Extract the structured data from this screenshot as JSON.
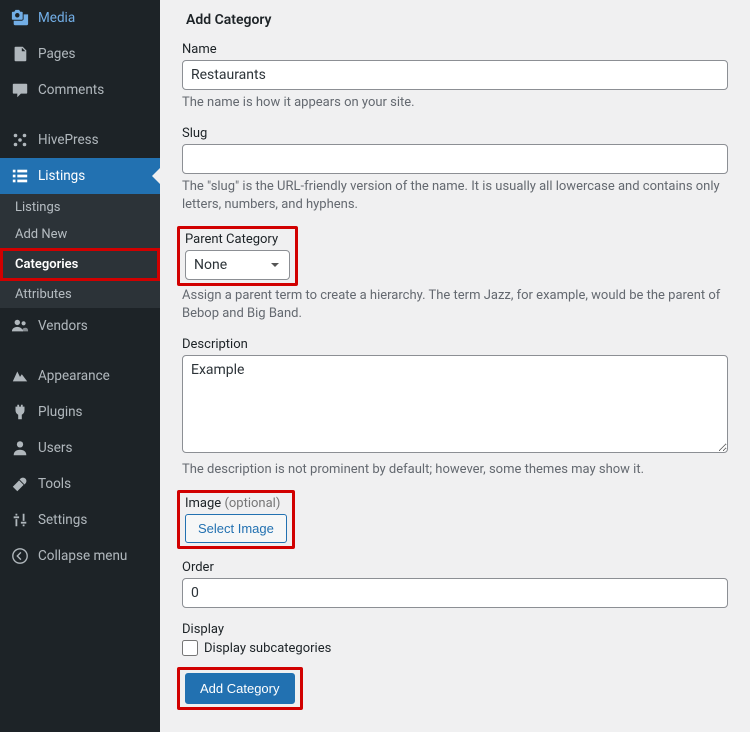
{
  "sidebar": {
    "items": [
      {
        "icon": "media",
        "label": "Media"
      },
      {
        "icon": "page",
        "label": "Pages"
      },
      {
        "icon": "comment",
        "label": "Comments"
      },
      {
        "icon": "hivepress",
        "label": "HivePress"
      },
      {
        "icon": "list",
        "label": "Listings"
      },
      {
        "icon": "vendor",
        "label": "Vendors"
      },
      {
        "icon": "appearance",
        "label": "Appearance"
      },
      {
        "icon": "plugin",
        "label": "Plugins"
      },
      {
        "icon": "user",
        "label": "Users"
      },
      {
        "icon": "tool",
        "label": "Tools"
      },
      {
        "icon": "settings",
        "label": "Settings"
      },
      {
        "icon": "collapse",
        "label": "Collapse menu"
      }
    ],
    "submenu": [
      "Listings",
      "Add New",
      "Categories",
      "Attributes"
    ],
    "active_index": 4,
    "submenu_current_index": 2
  },
  "page": {
    "title": "Add Category",
    "name_label": "Name",
    "name_value": "Restaurants",
    "name_help": "The name is how it appears on your site.",
    "slug_label": "Slug",
    "slug_value": "",
    "slug_help": "The \"slug\" is the URL-friendly version of the name. It is usually all lowercase and contains only letters, numbers, and hyphens.",
    "parent_label": "Parent Category",
    "parent_value": "None",
    "parent_help": "Assign a parent term to create a hierarchy. The term Jazz, for example, would be the parent of Bebop and Big Band.",
    "desc_label": "Description",
    "desc_value": "Example",
    "desc_help": "The description is not prominent by default; however, some themes may show it.",
    "image_label": "Image",
    "image_optional": "(optional)",
    "image_button": "Select Image",
    "order_label": "Order",
    "order_value": "0",
    "display_label": "Display",
    "display_checkbox": "Display subcategories",
    "submit": "Add Category"
  },
  "colors": {
    "accent": "#2271b1",
    "highlight": "#d10000"
  }
}
